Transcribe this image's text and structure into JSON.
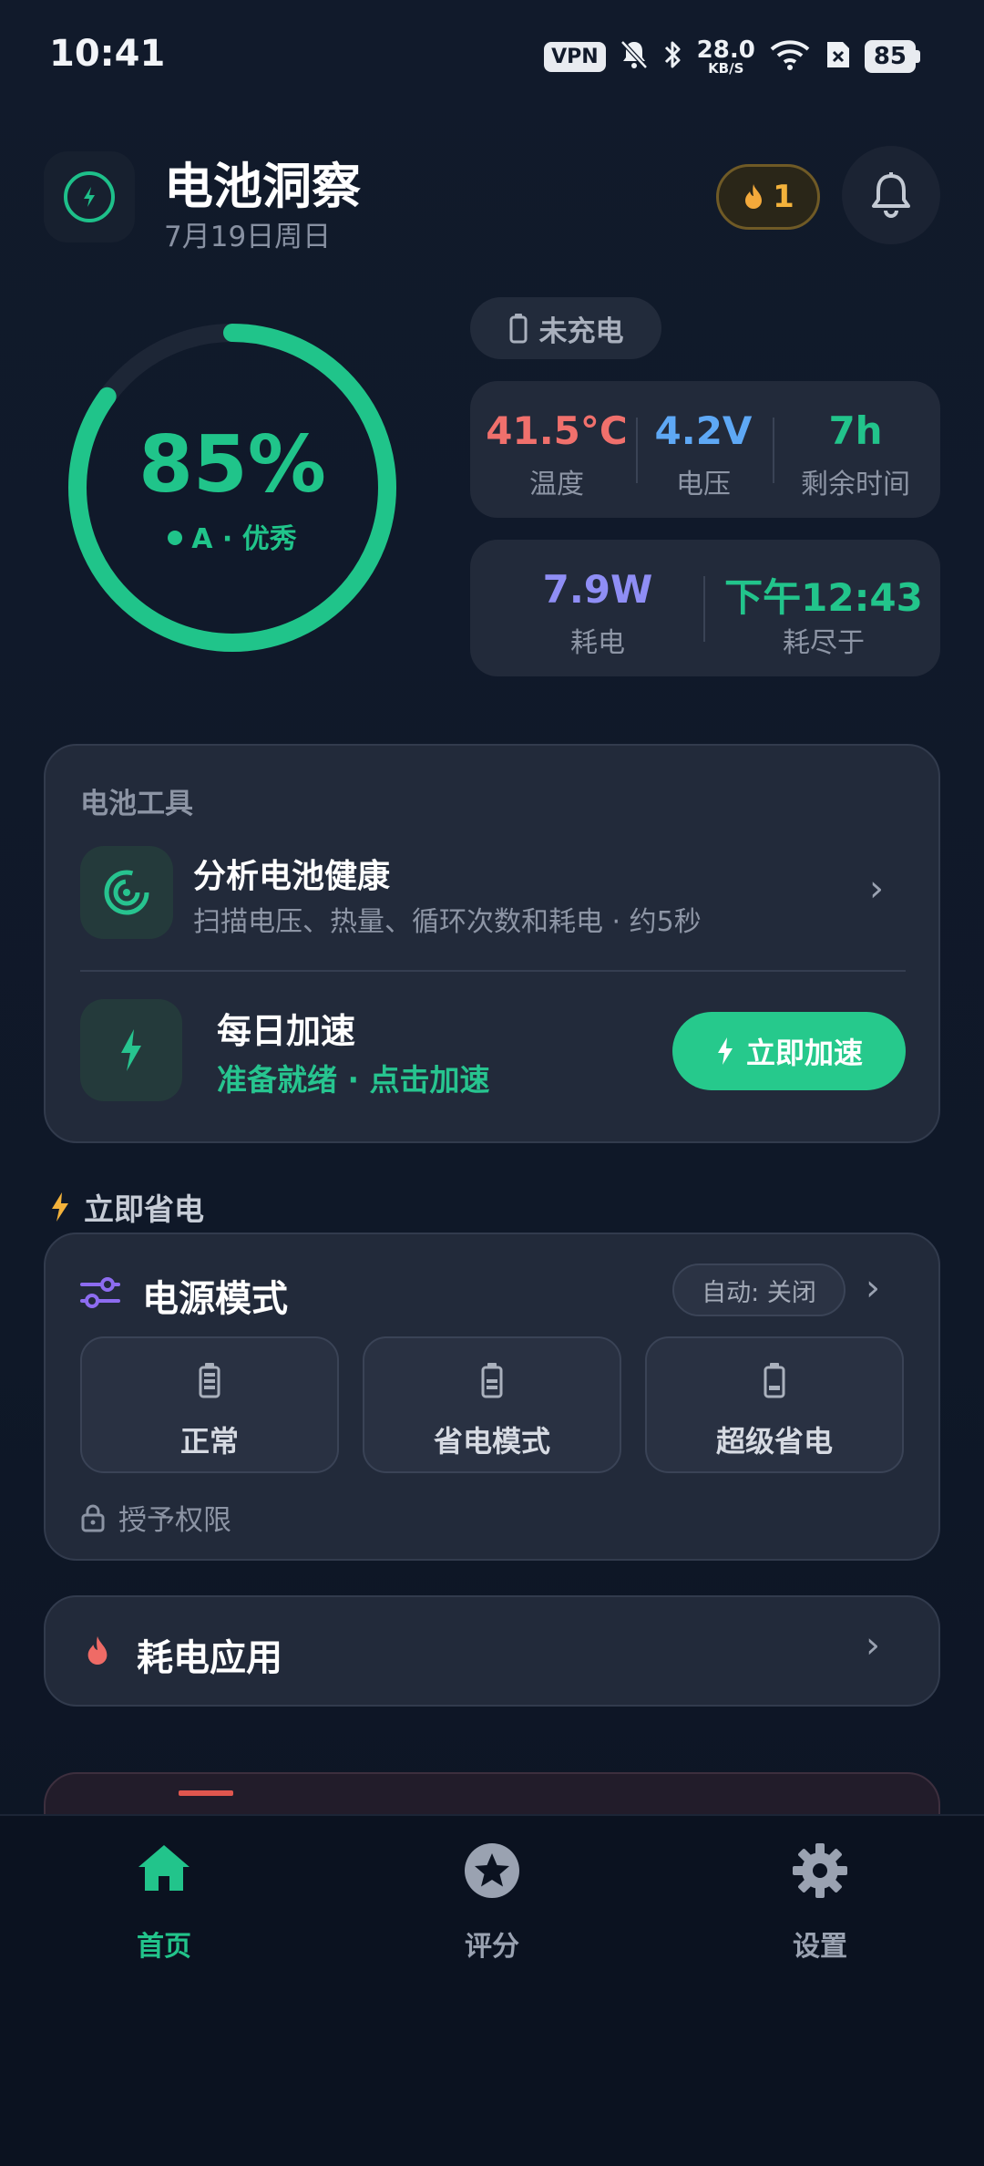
{
  "status_bar": {
    "time": "10:41",
    "vpn": "VPN",
    "net_speed_value": "28.0",
    "net_speed_unit": "KB/S",
    "battery": "85"
  },
  "header": {
    "title": "电池洞察",
    "date": "7月19日周日",
    "streak_count": "1"
  },
  "gauge": {
    "percent_text": "85%",
    "percent_value": 85,
    "grade": "A · 优秀",
    "color": "#20c48a"
  },
  "charge_status": "未充电",
  "stats_row1": [
    {
      "value": "41.5°C",
      "label": "温度",
      "color": "#f0706c"
    },
    {
      "value": "4.2V",
      "label": "电压",
      "color": "#5ea8f5"
    },
    {
      "value": "7h",
      "label": "剩余时间",
      "color": "#22c48b"
    }
  ],
  "stats_row2": [
    {
      "value": "7.9W",
      "label": "耗电",
      "color": "#8f8ef5"
    },
    {
      "value": "下午12:43",
      "label": "耗尽于",
      "color": "#22c48b"
    }
  ],
  "tools": {
    "section_label": "电池工具",
    "analyze_title": "分析电池健康",
    "analyze_sub": "扫描电压、热量、循环次数和耗电 · 约5秒",
    "daily_title": "每日加速",
    "daily_sub": "准备就绪 · 点击加速",
    "boost_button": "立即加速"
  },
  "save_section": {
    "heading": "立即省电"
  },
  "power_mode": {
    "title": "电源模式",
    "auto": "自动: 关闭",
    "modes": [
      "正常",
      "省电模式",
      "超级省电"
    ],
    "permission": "授予权限"
  },
  "drain_apps": {
    "title": "耗电应用"
  },
  "nav": {
    "items": [
      "首页",
      "评分",
      "设置"
    ],
    "active_color": "#22c48b",
    "inactive_color": "#9aa2b1"
  }
}
